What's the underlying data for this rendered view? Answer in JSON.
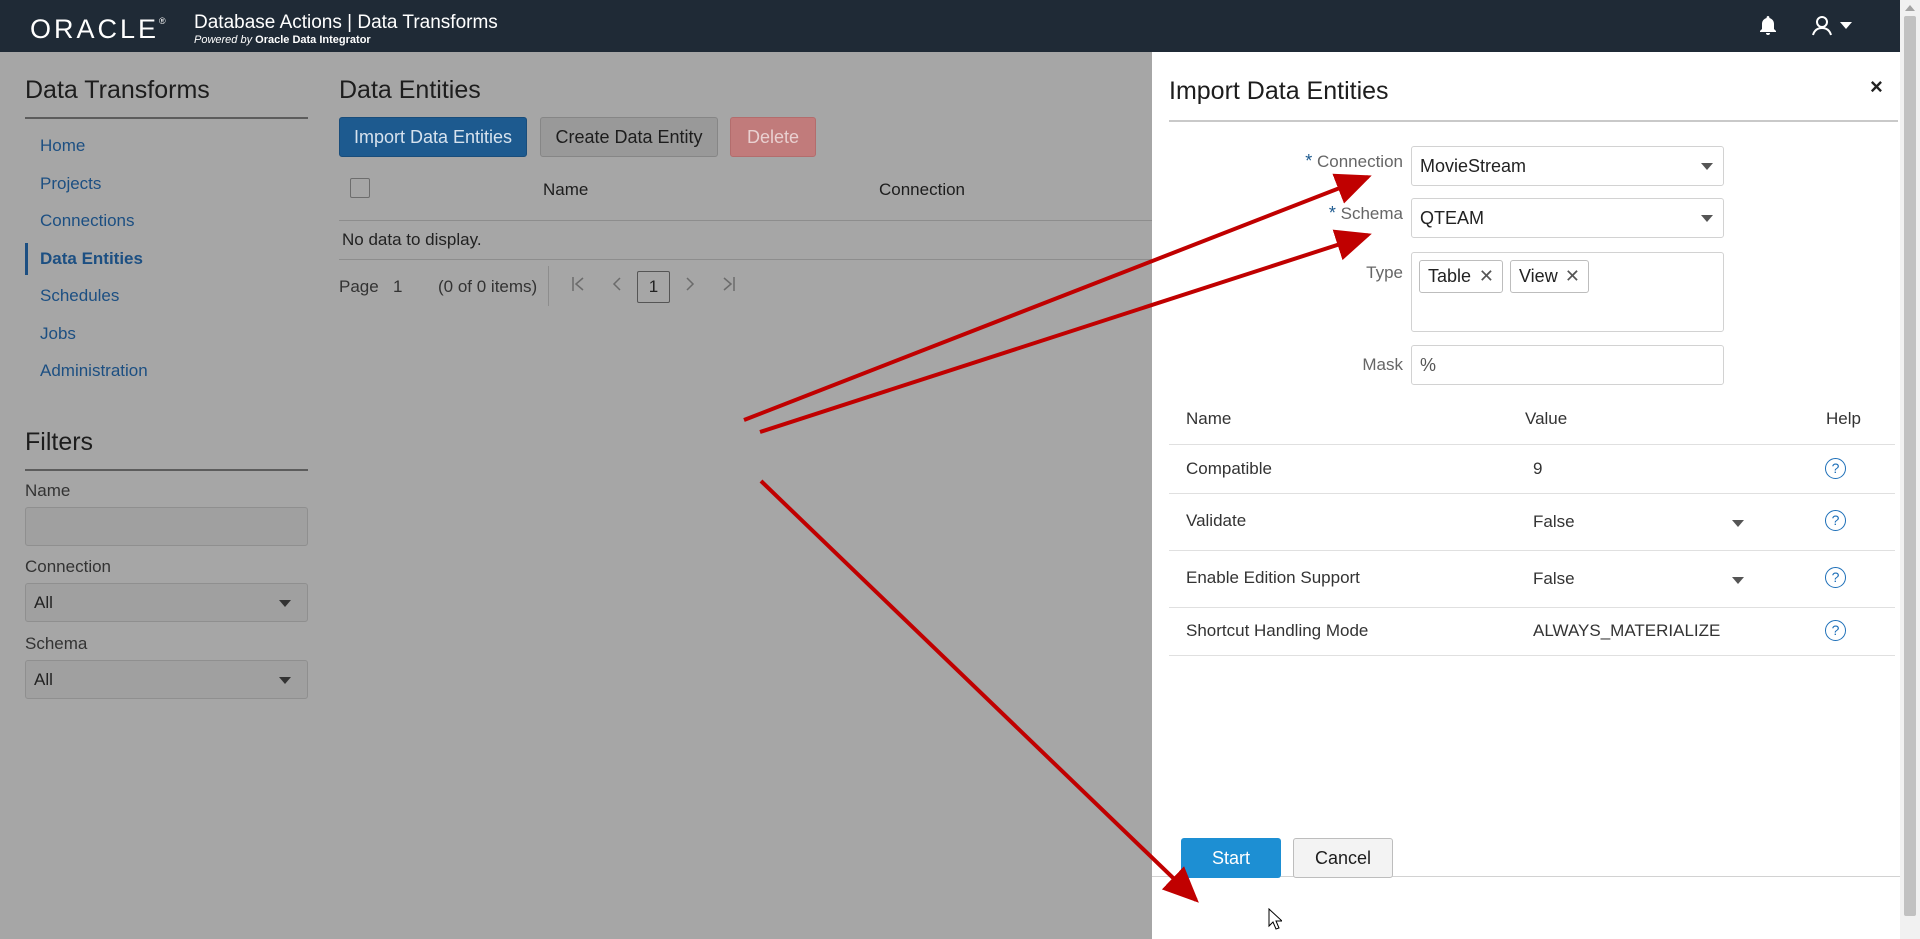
{
  "header": {
    "logo": "ORACLE",
    "logo_mark": "®",
    "title": "Database Actions | Data Transforms",
    "subtitle_powered": "Powered by",
    "subtitle_product": "Oracle Data Integrator"
  },
  "sidebar": {
    "title": "Data Transforms",
    "items": [
      {
        "label": "Home"
      },
      {
        "label": "Projects"
      },
      {
        "label": "Connections"
      },
      {
        "label": "Data Entities"
      },
      {
        "label": "Schedules"
      },
      {
        "label": "Jobs"
      },
      {
        "label": "Administration"
      }
    ],
    "active": "Data Entities"
  },
  "filters": {
    "title": "Filters",
    "name_label": "Name",
    "name_value": "",
    "connection_label": "Connection",
    "connection_value": "All",
    "schema_label": "Schema",
    "schema_value": "All"
  },
  "main": {
    "title": "Data Entities",
    "import_btn": "Import Data Entities",
    "create_btn": "Create Data Entity",
    "delete_btn": "Delete",
    "col_name": "Name",
    "col_connection": "Connection",
    "no_data": "No data to display.",
    "page_label": "Page",
    "page_num": "1",
    "items_info": "(0 of 0 items)",
    "current_page": "1"
  },
  "dialog": {
    "title": "Import Data Entities",
    "close": "×",
    "required_mark": "*",
    "connection_label": "Connection",
    "connection_value": "MovieStream",
    "schema_label": "Schema",
    "schema_value": "QTEAM",
    "type_label": "Type",
    "type_chips": [
      "Table",
      "View"
    ],
    "chip_remove": "✕",
    "mask_label": "Mask",
    "mask_value": "%",
    "params_head": {
      "name": "Name",
      "value": "Value",
      "help": "Help"
    },
    "params": [
      {
        "name": "Compatible",
        "value": "9"
      },
      {
        "name": "Validate",
        "value": "False"
      },
      {
        "name": "Enable Edition Support",
        "value": "False"
      },
      {
        "name": "Shortcut Handling Mode",
        "value": "ALWAYS_MATERIALIZE"
      }
    ],
    "help_glyph": "?",
    "start_btn": "Start",
    "cancel_btn": "Cancel"
  },
  "colors": {
    "header_bg": "#1f2a36",
    "primary": "#1d8fd3",
    "annotation_arrow": "#c00000"
  }
}
